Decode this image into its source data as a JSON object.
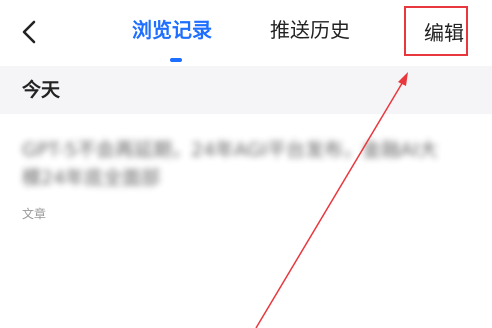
{
  "header": {
    "tabs": [
      {
        "label": "浏览记录",
        "active": true
      },
      {
        "label": "推送历史",
        "active": false
      }
    ],
    "edit_label": "编辑"
  },
  "section": {
    "title": "今天"
  },
  "history": [
    {
      "title": "GPT-5不会再延期，24年AGI平台发布，金融AI大模24年底全面部",
      "category": "文章"
    }
  ],
  "colors": {
    "accent": "#1e6fff",
    "annotation": "#e8383d",
    "section_bg": "#f5f5f7"
  }
}
